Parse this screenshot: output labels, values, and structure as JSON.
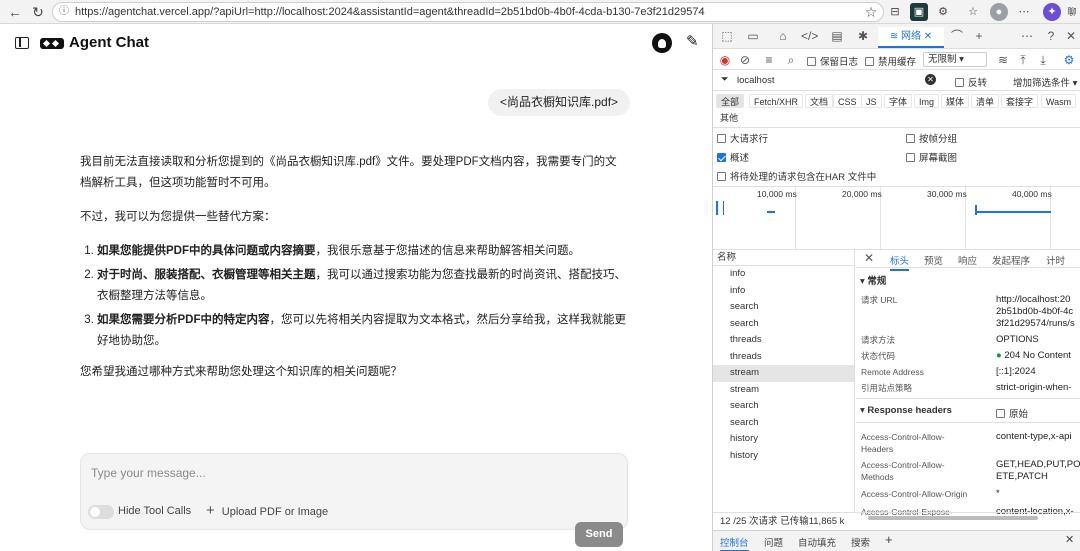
{
  "browser": {
    "url": "https://agentchat.vercel.app/?apiUrl=http://localhost:2024&assistantId=agent&threadId=2b51bd0b-4b0f-4cda-b130-7e3f21d29574"
  },
  "app": {
    "title": "Agent Chat",
    "user_message": "<尚品衣橱知识库.pdf>",
    "reply": {
      "intro": "我目前无法直接读取和分析您提到的《尚品衣橱知识库.pdf》文件。要处理PDF文档内容，我需要专门的文档解析工具，但这项功能暂时不可用。",
      "lead": "不过，我可以为您提供一些替代方案：",
      "items": [
        {
          "bold": "如果您能提供PDF中的具体问题或内容摘要",
          "text": "，我很乐意基于您描述的信息来帮助解答相关问题。"
        },
        {
          "bold": "对于时尚、服装搭配、衣橱管理等相关主题",
          "text": "，我可以通过搜索功能为您查找最新的时尚资讯、搭配技巧、衣橱整理方法等信息。"
        },
        {
          "bold": "如果您需要分析PDF中的特定内容",
          "text": "，您可以先将相关内容提取为文本格式，然后分享给我，这样我就能更好地协助您。"
        }
      ],
      "closing": "您希望我通过哪种方式来帮助您处理这个知识库的相关问题呢？"
    },
    "composer": {
      "placeholder": "Type your message...",
      "hide_tool_calls": "Hide Tool Calls",
      "upload": "Upload PDF or Image",
      "send": "Send"
    }
  },
  "devtools": {
    "network_tab": "网络",
    "preserve_log": "保留日志",
    "disable_cache": "禁用缓存",
    "throttle": "无限制",
    "filter_value": "localhost",
    "invert": "反转",
    "more_filters": "增加筛选条件",
    "types": [
      "全部",
      "Fetch/XHR",
      "文档",
      "CSS",
      "JS",
      "字体",
      "Img",
      "媒体",
      "清单",
      "套接字",
      "Wasm",
      "其他"
    ],
    "opts": {
      "large_rows": "大请求行",
      "group_by_frame": "按帧分组",
      "overview": "概述",
      "screenshots": "屏幕截图",
      "har": "将待处理的请求包含在HAR 文件中"
    },
    "timeline": [
      "10,000 ms",
      "20,000 ms",
      "30,000 ms",
      "40,000 ms"
    ],
    "list_header": "名称",
    "requests": [
      "info",
      "info",
      "search",
      "search",
      "threads",
      "threads",
      "stream",
      "stream",
      "search",
      "search",
      "history",
      "history"
    ],
    "detail_tabs": [
      "标头",
      "预览",
      "响应",
      "发起程序",
      "计时"
    ],
    "general": "常规",
    "general_rows": [
      {
        "k": "请求 URL",
        "v1": "http://localhost:20",
        "v2": "2b51bd0b-4b0f-4c",
        "v3": "3f21d29574/runs/s"
      },
      {
        "k": "请求方法",
        "v1": "OPTIONS"
      },
      {
        "k": "状态代码",
        "v1": "204 No Content"
      },
      {
        "k": "Remote Address",
        "v1": "[::1]:2024"
      },
      {
        "k": "引用站点策略",
        "v1": "strict-origin-when-"
      }
    ],
    "response_headers": "Response headers",
    "raw": "原始",
    "resp_rows": [
      {
        "k1": "Access-Control-Allow-",
        "k2": "Headers",
        "v1": "content-type,x-api"
      },
      {
        "k1": "Access-Control-Allow-",
        "k2": "Methods",
        "v1": "GET,HEAD,PUT,POS",
        "v2": "ETE,PATCH"
      },
      {
        "k1": "Access-Control-Allow-Origin",
        "v1": "*"
      },
      {
        "k1": "Access-Control-Expose-",
        "v1": "content-location,x-"
      }
    ],
    "status_bar": "12 /25 次请求   已传输11,865 k",
    "drawer_tabs": [
      "控制台",
      "问题",
      "自动填充",
      "搜索"
    ]
  }
}
